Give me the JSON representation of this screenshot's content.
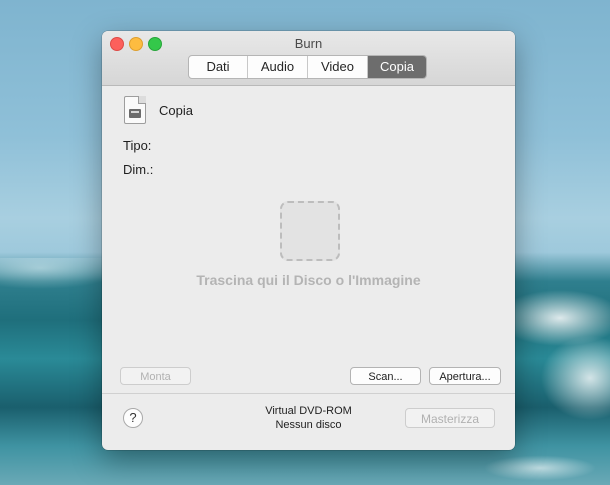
{
  "window": {
    "title": "Burn"
  },
  "tabs": [
    {
      "label": "Dati",
      "active": false
    },
    {
      "label": "Audio",
      "active": false
    },
    {
      "label": "Video",
      "active": false
    },
    {
      "label": "Copia",
      "active": true
    }
  ],
  "copy": {
    "name": "Copia",
    "type_label": "Tipo:",
    "size_label": "Dim.:",
    "drop_hint": "Trascina qui il Disco o l'Immagine"
  },
  "buttons": {
    "mount": "Monta",
    "scan": "Scan...",
    "open": "Apertura...",
    "burn": "Masterizza",
    "help": "?"
  },
  "device": {
    "name": "Virtual DVD-ROM",
    "status": "Nessun disco"
  },
  "colors": {
    "active_tab": "#6d6d6d",
    "close": "#fc605c",
    "minimize": "#fdbc40",
    "maximize": "#34c84a"
  }
}
